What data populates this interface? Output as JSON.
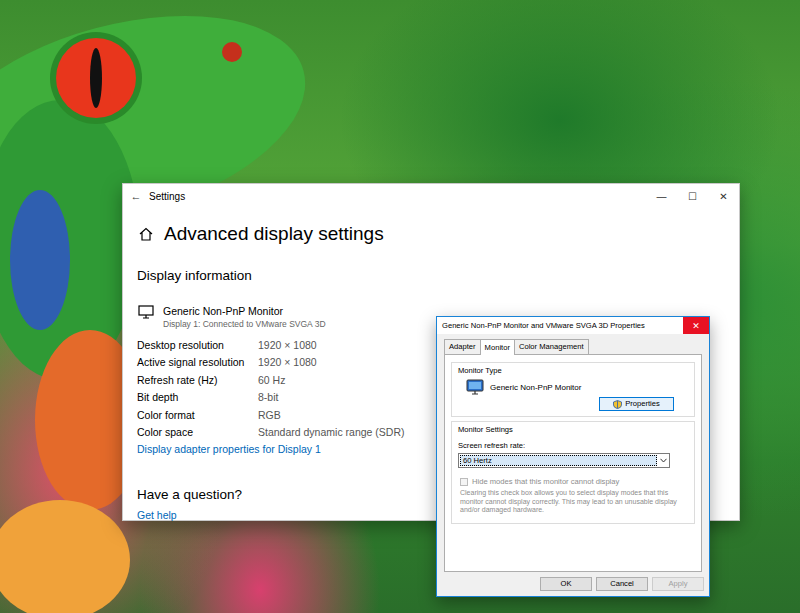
{
  "settings": {
    "window": {
      "back": "←",
      "title": "Settings",
      "controls": [
        "—",
        "☐",
        "✕"
      ]
    },
    "heading": "Advanced display settings",
    "section": "Display information",
    "monitor": {
      "name": "Generic Non-PnP Monitor",
      "connection": "Display 1: Connected to VMware SVGA 3D"
    },
    "info_rows": [
      {
        "label": "Desktop resolution",
        "value": "1920 × 1080"
      },
      {
        "label": "Active signal resolution",
        "value": "1920 × 1080"
      },
      {
        "label": "Refresh rate (Hz)",
        "value": "60 Hz"
      },
      {
        "label": "Bit depth",
        "value": "8-bit"
      },
      {
        "label": "Color format",
        "value": "RGB"
      },
      {
        "label": "Color space",
        "value": "Standard dynamic range (SDR)"
      }
    ],
    "adapter_link": "Display adapter properties for Display 1",
    "question": "Have a question?",
    "help_link": "Get help"
  },
  "dialog": {
    "title": "Generic Non-PnP Monitor and VMware SVGA 3D Properties",
    "close": "✕",
    "tabs": [
      {
        "label": "Adapter",
        "selected": false
      },
      {
        "label": "Monitor",
        "selected": true
      },
      {
        "label": "Color Management",
        "selected": false
      }
    ],
    "monitor_type": {
      "legend": "Monitor Type",
      "name": "Generic Non-PnP Monitor",
      "button": "Properties"
    },
    "monitor_settings": {
      "legend": "Monitor Settings",
      "refresh_label": "Screen refresh rate:",
      "refresh_value": "60 Hertz",
      "hide_modes": {
        "label": "Hide modes that this monitor cannot display",
        "checked": false,
        "disabled": true
      },
      "note": "Clearing this check box allows you to select display modes that this monitor cannot display correctly. This may lead to an unusable display and/or damaged hardware."
    },
    "buttons": [
      {
        "label": "OK",
        "disabled": false
      },
      {
        "label": "Cancel",
        "disabled": false
      },
      {
        "label": "Apply",
        "disabled": true
      }
    ]
  }
}
